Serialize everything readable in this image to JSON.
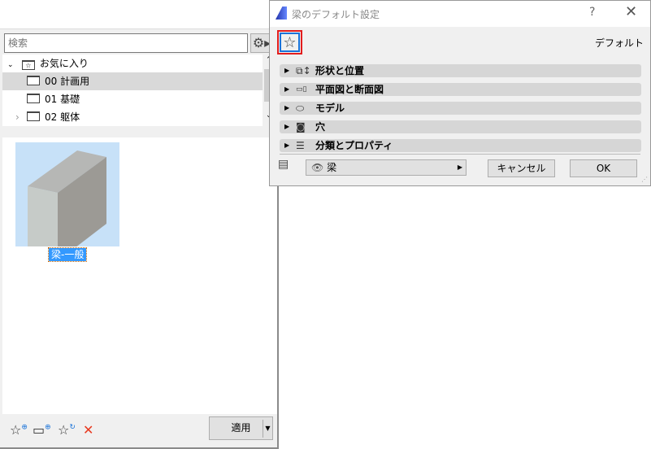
{
  "library": {
    "search_placeholder": "検索",
    "tree": [
      {
        "label": "お気に入り",
        "expanded": true
      },
      {
        "label": "00 計画用",
        "selected": true
      },
      {
        "label": "01 基礎"
      },
      {
        "label": "02 躯体",
        "collapsed": true
      }
    ],
    "item_label": "梁-一般",
    "apply_label": "適用"
  },
  "dialog": {
    "title": "梁のデフォルト設定",
    "help": "?",
    "close": "✕",
    "favorites_label": "デフォルト",
    "sections": [
      "形状と位置",
      "平面図と断面図",
      "モデル",
      "穴",
      "分類とプロパティ"
    ],
    "layer_value": "梁",
    "cancel_label": "キャンセル",
    "ok_label": "OK"
  },
  "colors": {
    "highlight": "#e21d1d",
    "accent": "#1a73d9",
    "selection": "#3399ff"
  }
}
